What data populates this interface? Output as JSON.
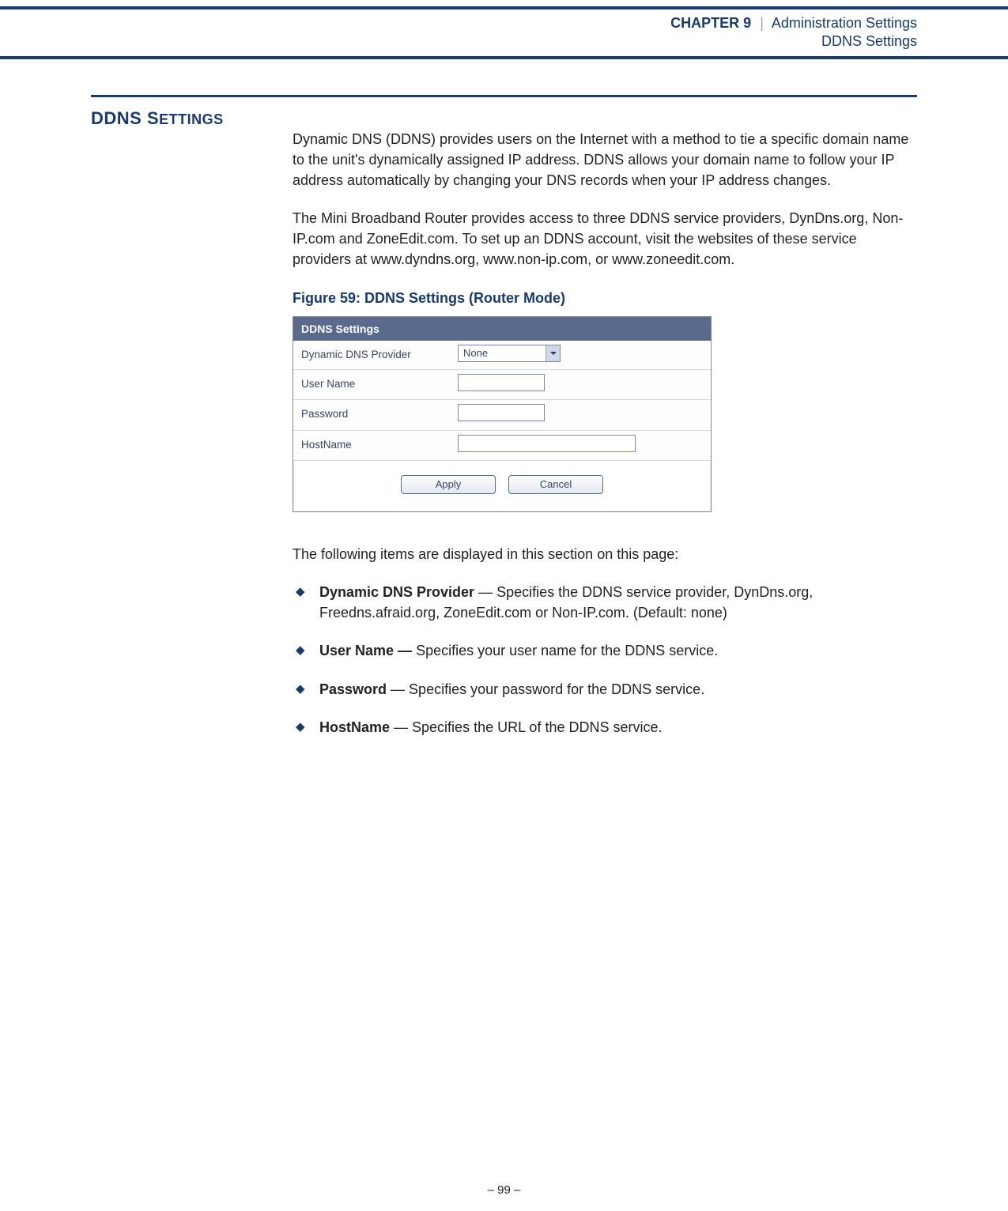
{
  "header": {
    "chapter_label": "CHAPTER 9",
    "separator": "|",
    "chapter_title": "Administration Settings",
    "subsection": "DDNS Settings"
  },
  "section": {
    "title_main": "DDNS S",
    "title_rest": "ETTINGS"
  },
  "body": {
    "para1": "Dynamic DNS (DDNS) provides users on the Internet with a method to tie a specific domain name to the unit's dynamically assigned IP address. DDNS allows your domain name to follow your IP address automatically by changing your DNS records when your IP address changes.",
    "para2": "The Mini Broadband Router provides access to three DDNS service providers, DynDns.org, Non-IP.com and ZoneEdit.com. To set up an DDNS account, visit the websites of these service providers at www.dyndns.org, www.non-ip.com, or www.zoneedit.com.",
    "fig_caption": "Figure 59:  DDNS Settings (Router Mode)",
    "lead_in": "The following items are displayed in this section on this page:"
  },
  "figure": {
    "panel_title": "DDNS Settings",
    "rows": {
      "provider_label": "Dynamic DNS Provider",
      "provider_value": "None",
      "username_label": "User Name",
      "password_label": "Password",
      "hostname_label": "HostName"
    },
    "buttons": {
      "apply": "Apply",
      "cancel": "Cancel"
    }
  },
  "items": [
    {
      "term": "Dynamic DNS Provider",
      "desc": " — Specifies the DDNS service provider, DynDns.org, Freedns.afraid.org, ZoneEdit.com or Non-IP.com. (Default: none)"
    },
    {
      "term": "User Name —",
      "desc": " Specifies your user name for the DDNS service."
    },
    {
      "term": "Password",
      "desc": " — Specifies your password for the DDNS service."
    },
    {
      "term": "HostName",
      "desc": " — Specifies the URL of the DDNS service."
    }
  ],
  "footer": {
    "page": "–  99  –"
  }
}
